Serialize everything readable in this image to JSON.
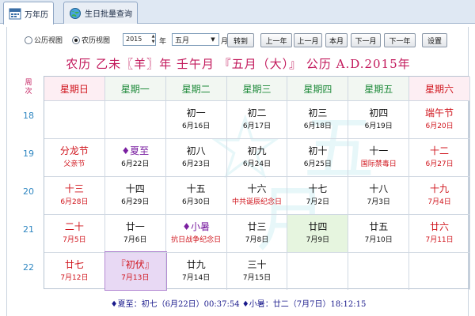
{
  "tabs": [
    {
      "label": "万年历",
      "icon": "calendar-icon",
      "active": true
    },
    {
      "label": "生日批量查询",
      "icon": "globe-icon",
      "active": false
    }
  ],
  "controls": {
    "radio_gregorian": "公历视图",
    "radio_lunar": "农历视图",
    "year_value": "2015",
    "year_suffix": "年",
    "month_value": "五月",
    "month_suffix": "月",
    "goto_label": "转到",
    "prev_year": "上一年",
    "prev_month": "上一月",
    "this_month": "本月",
    "next_month": "下一月",
    "next_year": "下一年",
    "settings": "设置"
  },
  "title": "农历 乙未〖羊〗年 壬午月 『五月（大）』 公历 A.D.2015年",
  "week_header": "周次",
  "weekdays": [
    "星期日",
    "星期一",
    "星期二",
    "星期三",
    "星期四",
    "星期五",
    "星期六"
  ],
  "weeks": [
    "18",
    "19",
    "20",
    "21",
    "22"
  ],
  "rows": [
    [
      {
        "lunar": "",
        "solar": ""
      },
      {
        "lunar": "",
        "solar": ""
      },
      {
        "lunar": "初一",
        "solar": "6月16日"
      },
      {
        "lunar": "初二",
        "solar": "6月17日"
      },
      {
        "lunar": "初三",
        "solar": "6月18日"
      },
      {
        "lunar": "初四",
        "solar": "6月19日"
      },
      {
        "lunar": "端午节",
        "solar": "6月20日",
        "style": "red"
      }
    ],
    [
      {
        "lunar": "分龙节",
        "solar": "父亲节",
        "style": "red",
        "solar_style": "red"
      },
      {
        "lunar": "♦夏至",
        "solar": "6月22日",
        "style": "purple"
      },
      {
        "lunar": "初八",
        "solar": "6月23日"
      },
      {
        "lunar": "初九",
        "solar": "6月24日"
      },
      {
        "lunar": "初十",
        "solar": "6月25日"
      },
      {
        "lunar": "十一",
        "solar": "国际禁毒日",
        "solar_style": "red"
      },
      {
        "lunar": "十二",
        "solar": "6月27日",
        "style": "red"
      }
    ],
    [
      {
        "lunar": "十三",
        "solar": "6月28日",
        "style": "red"
      },
      {
        "lunar": "十四",
        "solar": "6月29日"
      },
      {
        "lunar": "十五",
        "solar": "6月30日"
      },
      {
        "lunar": "十六",
        "solar": "中共诞辰纪念日",
        "solar_style": "red"
      },
      {
        "lunar": "十七",
        "solar": "7月2日"
      },
      {
        "lunar": "十八",
        "solar": "7月3日"
      },
      {
        "lunar": "十九",
        "solar": "7月4日",
        "style": "red"
      }
    ],
    [
      {
        "lunar": "二十",
        "solar": "7月5日",
        "style": "red"
      },
      {
        "lunar": "廿一",
        "solar": "7月6日"
      },
      {
        "lunar": "♦小暑",
        "solar": "抗日战争纪念日",
        "style": "purple",
        "solar_style": "red"
      },
      {
        "lunar": "廿三",
        "solar": "7月8日"
      },
      {
        "lunar": "廿四",
        "solar": "7月9日",
        "highlight": "green"
      },
      {
        "lunar": "廿五",
        "solar": "7月10日"
      },
      {
        "lunar": "廿六",
        "solar": "7月11日",
        "style": "red"
      }
    ],
    [
      {
        "lunar": "廿七",
        "solar": "7月12日",
        "style": "red"
      },
      {
        "lunar": "『初伏』",
        "solar": "7月13日",
        "style": "red",
        "highlight": "purple"
      },
      {
        "lunar": "廿九",
        "solar": "7月14日"
      },
      {
        "lunar": "三十",
        "solar": "7月15日"
      },
      {
        "lunar": "",
        "solar": ""
      },
      {
        "lunar": "",
        "solar": ""
      },
      {
        "lunar": "",
        "solar": ""
      }
    ]
  ],
  "footer": "♦夏至：初七（6月22日）00:37:54  ♦小暑：廿二（7月7日）18:12:15",
  "colors": {
    "title": "#c2185b",
    "holiday": "#d0151d",
    "solarterm": "#7a1fa0",
    "weekday_header": "#1e8a3a"
  }
}
